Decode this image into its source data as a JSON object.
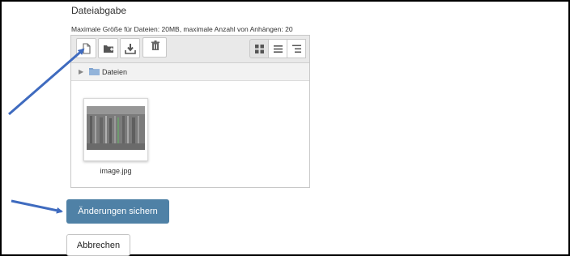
{
  "section": {
    "title": "Dateiabgabe",
    "max_info": "Maximale Größe für Dateien: 20MB, maximale Anzahl von Anhängen: 20"
  },
  "filemanager": {
    "toolbar": {
      "buttons": [
        "add-file-icon",
        "create-folder-icon",
        "download-icon",
        "delete-icon"
      ],
      "view_modes": [
        "icons-view-icon",
        "list-view-icon",
        "tree-view-icon"
      ],
      "active_view": "icons"
    },
    "path": {
      "folder_label": "Dateien"
    },
    "files": [
      {
        "name": "image.jpg"
      }
    ]
  },
  "actions": {
    "save_label": "Änderungen sichern",
    "cancel_label": "Abbrechen"
  },
  "colors": {
    "primary": "#4f81a6",
    "arrow": "#3f6bbf",
    "folder": "#7fa3cf"
  }
}
